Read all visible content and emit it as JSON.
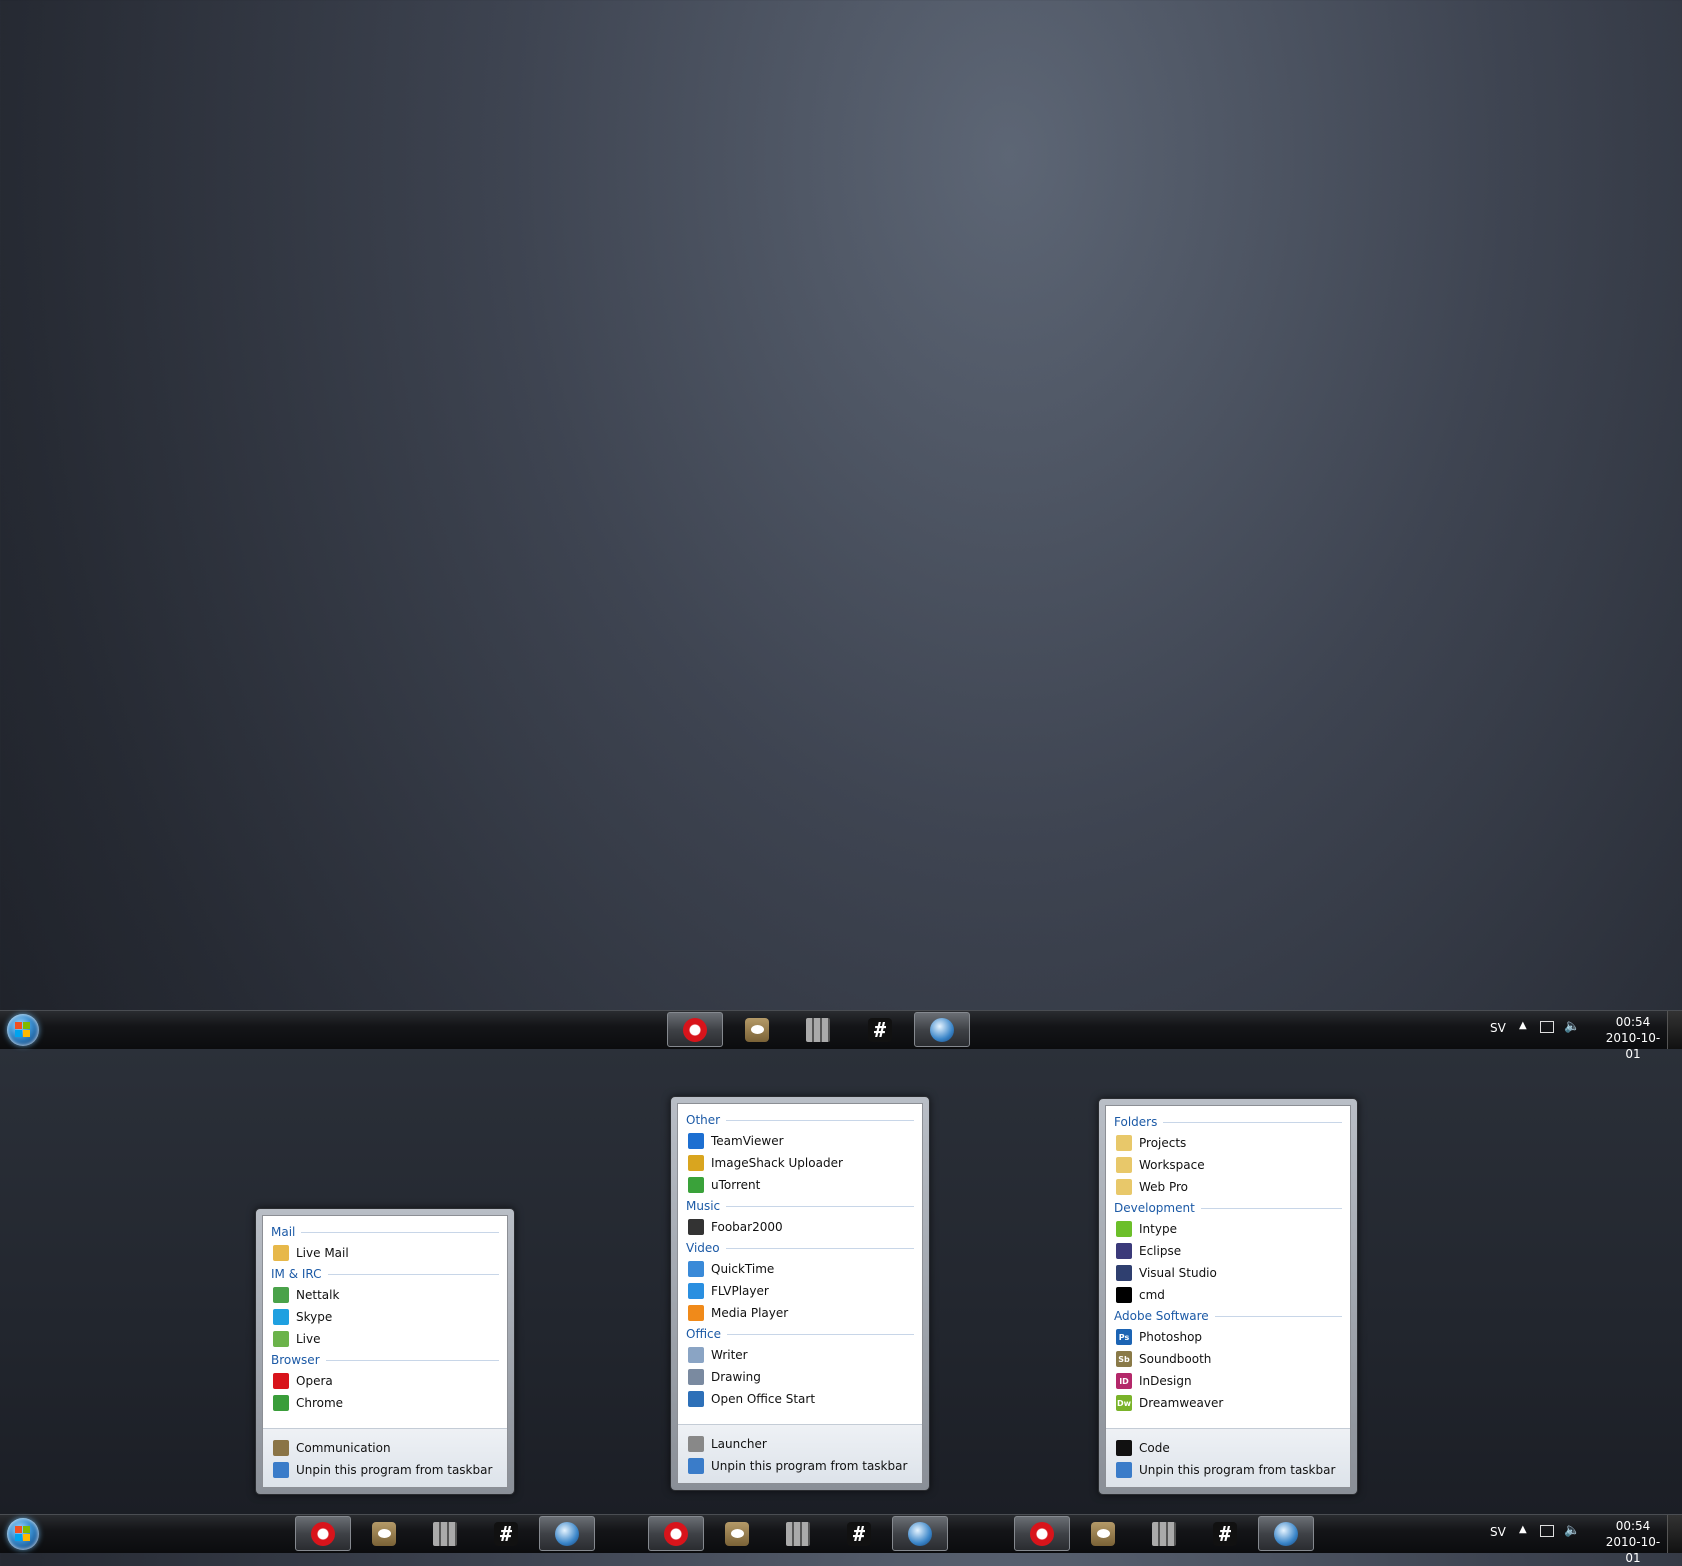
{
  "taskbar_top": {
    "buttons": [
      {
        "name": "opera",
        "icon": "opera-icon",
        "active": true
      },
      {
        "name": "communication",
        "icon": "chat-bubble-icon",
        "active": false
      },
      {
        "name": "launcher",
        "icon": "grid-icon",
        "active": false
      },
      {
        "name": "code",
        "icon": "hash-icon",
        "active": false
      },
      {
        "name": "globe",
        "icon": "globe-icon",
        "active": true
      }
    ]
  },
  "tray": {
    "lang": "SV",
    "time": "00:54",
    "date": "2010-10-01"
  },
  "jumplist_left": {
    "groups": [
      {
        "category": "Mail",
        "items": [
          {
            "label": "Live Mail",
            "icon": "mail-icon",
            "color": "#e7b84a"
          }
        ]
      },
      {
        "category": "IM & IRC",
        "items": [
          {
            "label": "Nettalk",
            "icon": "nettalk-icon",
            "color": "#4aa24a"
          },
          {
            "label": "Skype",
            "icon": "skype-icon",
            "color": "#1fa0e0"
          },
          {
            "label": "Live",
            "icon": "live-messenger-icon",
            "color": "#6bb34a"
          }
        ]
      },
      {
        "category": "Browser",
        "items": [
          {
            "label": "Opera",
            "icon": "opera-icon",
            "color": "#d8141b"
          },
          {
            "label": "Chrome",
            "icon": "chrome-icon",
            "color": "#3a9d3a"
          }
        ]
      }
    ],
    "footer": [
      {
        "label": "Communication",
        "icon": "chat-bubble-icon",
        "color": "#8a7446"
      },
      {
        "label": "Unpin this program from taskbar",
        "icon": "unpin-icon",
        "color": "#3a7cc9"
      }
    ]
  },
  "jumplist_middle": {
    "groups": [
      {
        "category": "Other",
        "items": [
          {
            "label": "TeamViewer",
            "icon": "teamviewer-icon",
            "color": "#1d6fd1"
          },
          {
            "label": "ImageShack Uploader",
            "icon": "imageshack-icon",
            "color": "#d9a51f"
          },
          {
            "label": "uTorrent",
            "icon": "utorrent-icon",
            "color": "#3aa23a"
          }
        ]
      },
      {
        "category": "Music",
        "items": [
          {
            "label": "Foobar2000",
            "icon": "foobar-icon",
            "color": "#333333"
          }
        ]
      },
      {
        "category": "Video",
        "items": [
          {
            "label": "QuickTime",
            "icon": "quicktime-icon",
            "color": "#3a8ad8"
          },
          {
            "label": "FLVPlayer",
            "icon": "flvplayer-icon",
            "color": "#2a8fe0"
          },
          {
            "label": "Media Player",
            "icon": "media-player-icon",
            "color": "#f08a1a"
          }
        ]
      },
      {
        "category": "Office",
        "items": [
          {
            "label": "Writer",
            "icon": "writer-icon",
            "color": "#8aa4c4"
          },
          {
            "label": "Drawing",
            "icon": "drawing-icon",
            "color": "#7a8aa0"
          },
          {
            "label": "Open Office Start",
            "icon": "openoffice-icon",
            "color": "#2e70b8"
          }
        ]
      }
    ],
    "footer": [
      {
        "label": "Launcher",
        "icon": "grid-icon",
        "color": "#888888"
      },
      {
        "label": "Unpin this program from taskbar",
        "icon": "unpin-icon",
        "color": "#3a7cc9"
      }
    ]
  },
  "jumplist_right": {
    "groups": [
      {
        "category": "Folders",
        "items": [
          {
            "label": "Projects",
            "icon": "folder-icon",
            "color": "#e8c86a"
          },
          {
            "label": "Workspace",
            "icon": "folder-icon",
            "color": "#e8c86a"
          },
          {
            "label": "Web Pro",
            "icon": "folder-icon",
            "color": "#e8c86a"
          }
        ]
      },
      {
        "category": "Development",
        "items": [
          {
            "label": "Intype",
            "icon": "intype-icon",
            "color": "#6cbf2a"
          },
          {
            "label": "Eclipse",
            "icon": "eclipse-icon",
            "color": "#3b3a7a"
          },
          {
            "label": "Visual Studio",
            "icon": "visual-studio-icon",
            "color": "#2f3f6f"
          },
          {
            "label": "cmd",
            "icon": "cmd-icon",
            "color": "#000000"
          }
        ]
      },
      {
        "category": "Adobe Software",
        "items": [
          {
            "label": "Photoshop",
            "icon": "photoshop-icon",
            "color": "#1c64b4",
            "abbr": "Ps"
          },
          {
            "label": "Soundbooth",
            "icon": "soundbooth-icon",
            "color": "#8a7a48",
            "abbr": "Sb"
          },
          {
            "label": "InDesign",
            "icon": "indesign-icon",
            "color": "#b4286a",
            "abbr": "ID"
          },
          {
            "label": "Dreamweaver",
            "icon": "dreamweaver-icon",
            "color": "#7ab32a",
            "abbr": "Dw"
          }
        ]
      }
    ],
    "footer": [
      {
        "label": "Code",
        "icon": "hash-icon",
        "color": "#111111"
      },
      {
        "label": "Unpin this program from taskbar",
        "icon": "unpin-icon",
        "color": "#3a7cc9"
      }
    ]
  },
  "taskbar_bottom": {
    "groups_count": 3
  }
}
